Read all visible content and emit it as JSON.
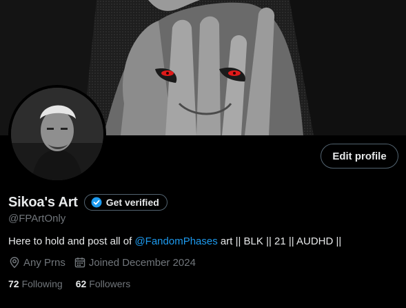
{
  "profile": {
    "display_name": "Sikoa's Art",
    "handle": "@FPArtOnly",
    "bio_prefix": "Here to hold and post all of ",
    "bio_mention": "@FandomPhases",
    "bio_suffix": " art || BLK || 21 || AUDHD ||",
    "location": "Any Prns",
    "joined": "Joined December 2024",
    "following_count": "72",
    "following_label": "Following",
    "followers_count": "62",
    "followers_label": "Followers"
  },
  "buttons": {
    "edit_profile": "Edit profile",
    "get_verified": "Get verified"
  },
  "icons": {
    "verify": "verified-badge-icon",
    "location": "location-pin-icon",
    "calendar": "calendar-icon"
  },
  "colors": {
    "background": "#000000",
    "accent": "#1d9bf0",
    "text": "#e7e9ea",
    "muted": "#71767b",
    "border": "#536471"
  }
}
